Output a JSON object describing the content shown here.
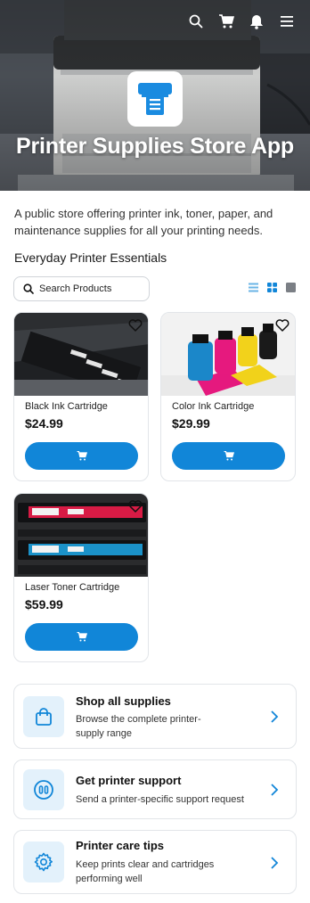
{
  "header": {
    "app_title": "Printer Supplies Store App",
    "icons": [
      "search-icon",
      "cart-icon",
      "bell-icon",
      "menu-icon"
    ]
  },
  "intro": {
    "description": "A public store offering printer ink, toner, paper, and maintenance supplies for all your printing needs.",
    "section_title": "Everyday Printer Essentials"
  },
  "search": {
    "placeholder": "Search Products"
  },
  "view_modes": [
    "list-view-icon",
    "grid-view-icon",
    "single-view-icon"
  ],
  "products": [
    {
      "name": "Black Ink Cartridge",
      "price": "$24.99"
    },
    {
      "name": "Color Ink Cartridge",
      "price": "$29.99"
    },
    {
      "name": "Laser Toner Cartridge",
      "price": "$59.99"
    }
  ],
  "links": [
    {
      "title": "Shop all supplies",
      "subtitle": "Browse the complete printer-supply range",
      "icon": "bag-icon"
    },
    {
      "title": "Get printer support",
      "subtitle": "Send a printer-specific support request",
      "icon": "support-icon"
    },
    {
      "title": "Printer care tips",
      "subtitle": "Keep prints clear and cartridges performing well",
      "icon": "gear-icon"
    }
  ],
  "colors": {
    "accent": "#1186d8",
    "icon_bg": "#e3f1fb",
    "border": "#e2e5e9"
  }
}
